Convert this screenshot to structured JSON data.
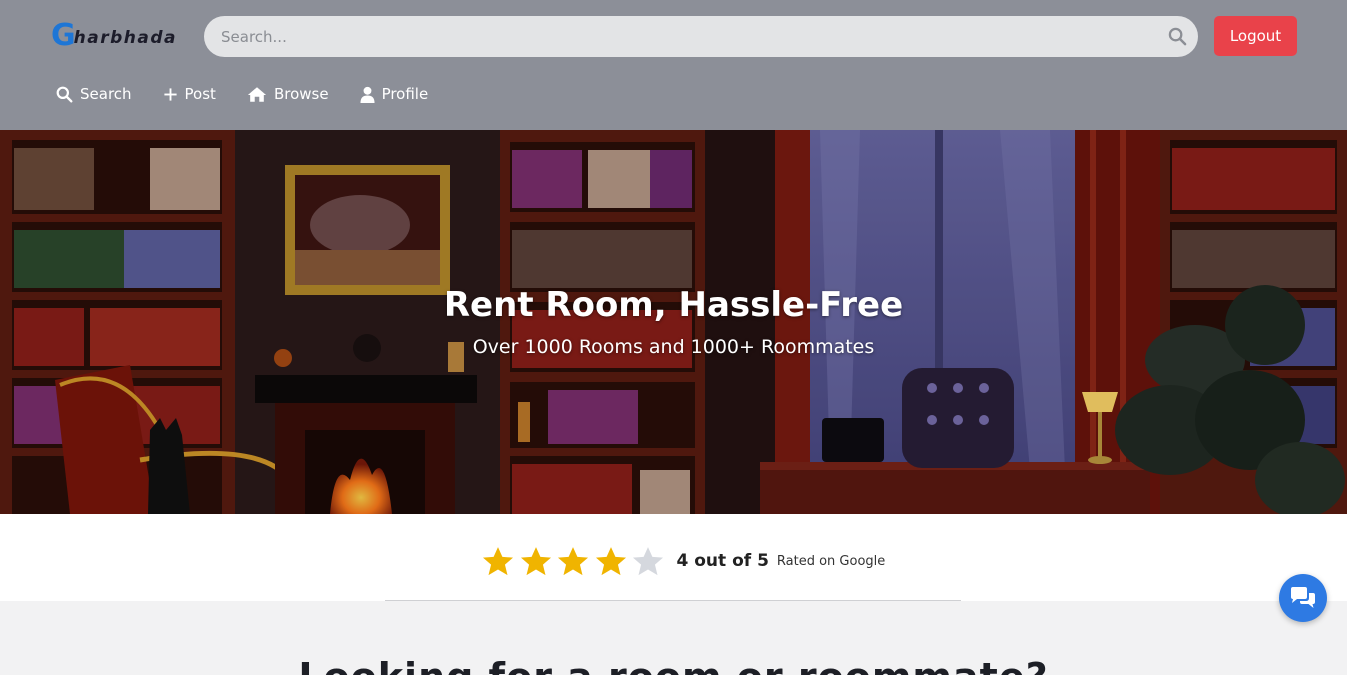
{
  "header": {
    "logo": {
      "first_letter": "G",
      "rest": "harbhada"
    },
    "search": {
      "placeholder": "Search..."
    },
    "logout_label": "Logout",
    "nav": [
      {
        "label": "Search",
        "icon": "search-icon"
      },
      {
        "label": "Post",
        "icon": "plus-icon"
      },
      {
        "label": "Browse",
        "icon": "home-icon"
      },
      {
        "label": "Profile",
        "icon": "user-icon"
      }
    ]
  },
  "hero": {
    "title": "Rent Room, Hassle-Free",
    "subtitle": "Over 1000 Rooms and 1000+ Roommates"
  },
  "rating": {
    "stars_filled": 4,
    "stars_total": 5,
    "value_text": "4 out of 5",
    "note": "Rated on Google"
  },
  "section": {
    "heading": "Looking for a room or roommate?"
  },
  "chat": {
    "icon": "chat-icon"
  },
  "colors": {
    "header_bg": "#8c8f98",
    "logout_bg": "#e9424a",
    "brand_blue": "#1e76d6",
    "star_filled": "#f0b400",
    "star_empty": "#d5d8de",
    "chat_bg": "#2e7ae3"
  }
}
